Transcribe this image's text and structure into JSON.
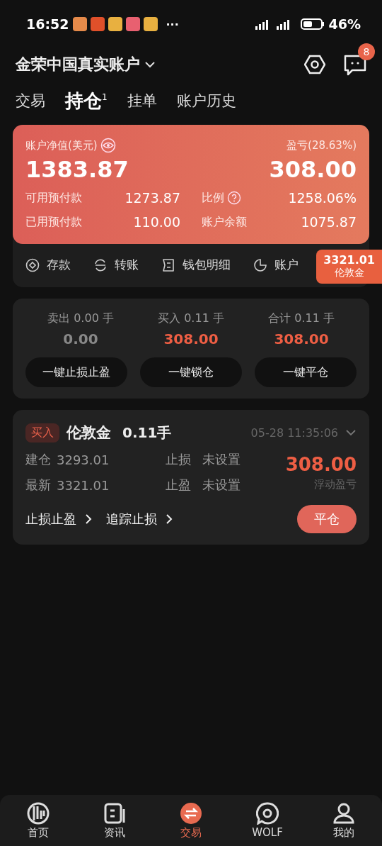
{
  "status_bar": {
    "time": "16:52",
    "more": "···",
    "battery_level": "46%"
  },
  "header": {
    "account": "金荣中国真实账户",
    "message_badge": "8"
  },
  "tabs": [
    {
      "label": "交易",
      "selected": false
    },
    {
      "label": "持仓",
      "selected": true,
      "badge": "1"
    },
    {
      "label": "挂单",
      "selected": false
    },
    {
      "label": "账户历史",
      "selected": false
    }
  ],
  "account_card": {
    "equity_label": "账户净值(美元)",
    "equity": "1383.87",
    "pnl_label": "盈亏(28.63%)",
    "pnl": "308.00",
    "stats": [
      {
        "label": "可用预付款",
        "value": "1273.87"
      },
      {
        "label": "比例",
        "value": "1258.06%",
        "help": true
      },
      {
        "label": "已用预付款",
        "value": "110.00"
      },
      {
        "label": "账户余额",
        "value": "1075.87"
      }
    ]
  },
  "actions": [
    {
      "kind": "deposit",
      "label": "存款"
    },
    {
      "kind": "transfer",
      "label": "转账"
    },
    {
      "kind": "wallet",
      "label": "钱包明细"
    },
    {
      "kind": "analysis",
      "label": "账户"
    }
  ],
  "price_tag": {
    "price": "3321.01",
    "symbol": "伦敦金"
  },
  "summary": {
    "columns": [
      {
        "label": "卖出 0.00 手",
        "value": "0.00",
        "positive": false
      },
      {
        "label": "买入 0.11 手",
        "value": "308.00",
        "positive": true
      },
      {
        "label": "合计 0.11 手",
        "value": "308.00",
        "positive": true
      }
    ],
    "buttons": [
      "一键止损止盈",
      "一键锁仓",
      "一键平仓"
    ]
  },
  "position": {
    "side": "买入",
    "symbol": "伦敦金",
    "lots": "0.11手",
    "time": "05-28 11:35:06",
    "rows": [
      {
        "label": "建仓",
        "value": "3293.01",
        "sl_label": "止损",
        "sl_value": "未设置"
      },
      {
        "label": "最新",
        "value": "3321.01",
        "sl_label": "止盈",
        "sl_value": "未设置"
      }
    ],
    "pnl": "308.00",
    "pnl_label": "浮动盈亏",
    "links": [
      "止损止盈",
      "追踪止损"
    ],
    "close_button": "平仓"
  },
  "bottom_nav": [
    {
      "kind": "home",
      "label": "首页",
      "selected": false
    },
    {
      "kind": "news",
      "label": "资讯",
      "selected": false
    },
    {
      "kind": "trade",
      "label": "交易",
      "selected": true
    },
    {
      "kind": "wolf",
      "label": "WOLF",
      "selected": false
    },
    {
      "kind": "me",
      "label": "我的",
      "selected": false
    }
  ]
}
